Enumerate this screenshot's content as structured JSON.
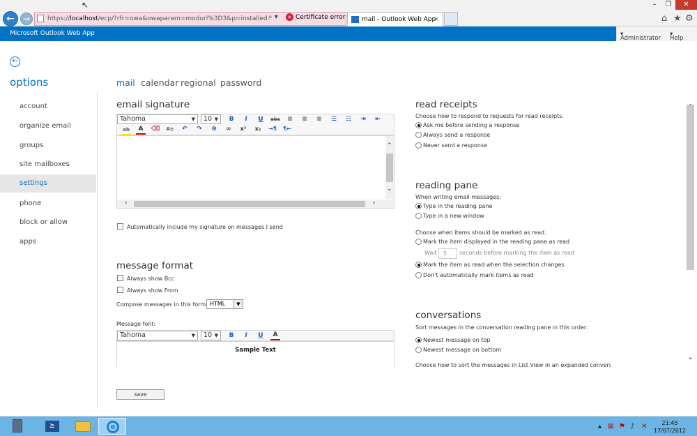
{
  "browser": {
    "url_prefix": "https://",
    "url_host": "localhost",
    "url_rest": "/ecp/?rfr=owa&owaparam=modurl%3D3&p=installed",
    "cert_error": "Certificate error",
    "tab_title": "mail - Outlook Web App"
  },
  "app": {
    "title": "Microsoft Outlook Web App",
    "admin_menu": "Administrator",
    "help_menu": "Help"
  },
  "sidebar": {
    "title": "options",
    "items": [
      "account",
      "organize email",
      "groups",
      "site mailboxes",
      "settings",
      "phone",
      "block or allow",
      "apps"
    ]
  },
  "tabs": [
    "mail",
    "calendar",
    "regional",
    "password"
  ],
  "signature": {
    "heading": "email signature",
    "font": "Tahoma",
    "size": "10",
    "auto_include": "Automatically include my signature on messages I send"
  },
  "message_format": {
    "heading": "message format",
    "always_bcc": "Always show Bcc",
    "always_from": "Always show From",
    "compose_label": "Compose messages in this format:",
    "compose_value": "HTML",
    "font_label": "Message font:",
    "font": "Tahoma",
    "size": "10",
    "sample": "Sample Text"
  },
  "save_label": "save",
  "read_receipts": {
    "heading": "read receipts",
    "description": "Choose how to respond to requests for read receipts.",
    "options": [
      "Ask me before sending a response",
      "Always send a response",
      "Never send a response"
    ]
  },
  "reading_pane": {
    "heading": "reading pane",
    "writing_label": "When writing email messages:",
    "writing_options": [
      "Type in the reading pane",
      "Type in a new window"
    ],
    "mark_label": "Choose when items should be marked as read.",
    "mark_displayed": "Mark the item displayed in the reading pane as read",
    "wait_prefix": "Wait",
    "wait_value": "5",
    "wait_suffix": "seconds before marking the item as read",
    "mark_selection": "Mark the item as read when the selection changes",
    "dont_mark": "Don't automatically mark items as read"
  },
  "conversations": {
    "heading": "conversations",
    "description": "Sort messages in the conversation reading pane in this order:",
    "options": [
      "Newest message on top",
      "Newest message on bottom"
    ],
    "cut_text": "Choose how to sort the messages in List View in an expanded conversation"
  },
  "taskbar": {
    "time": "21:45",
    "date": "17/07/2012"
  }
}
